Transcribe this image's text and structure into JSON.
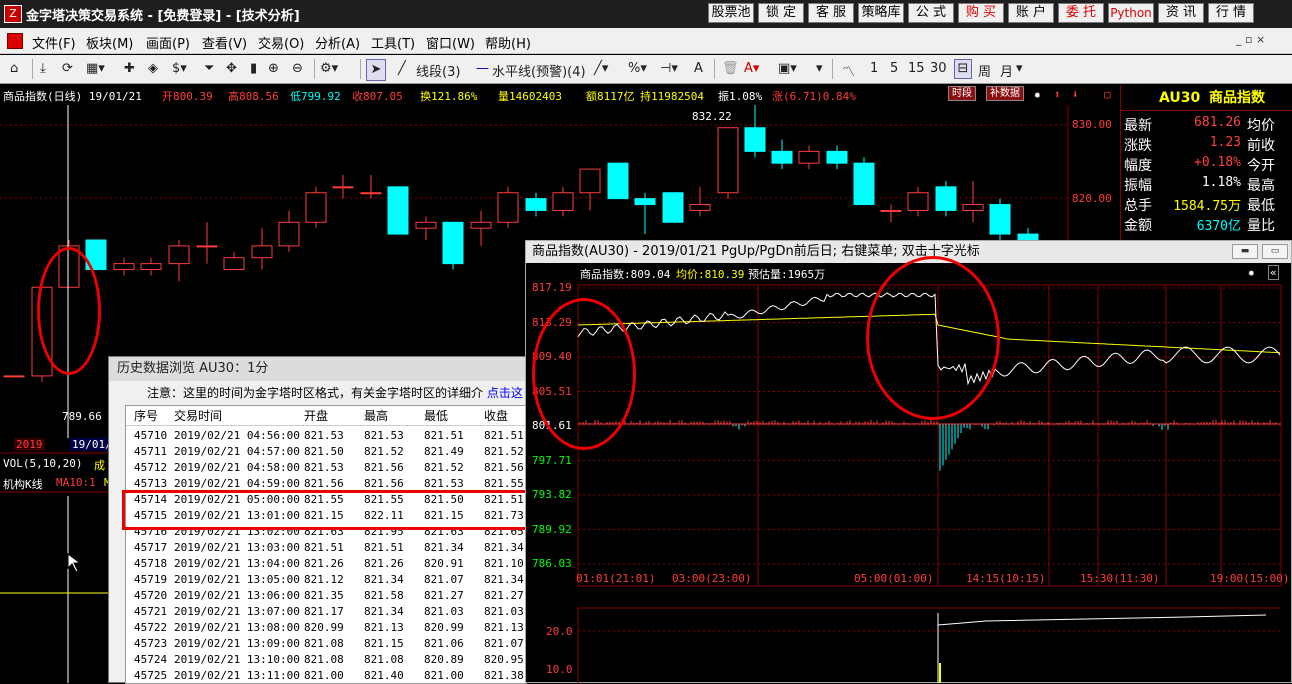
{
  "title": {
    "app_name": "金字塔决策交易系统 - [免费登录] - [技术分析]",
    "logo": "Z",
    "buttons": [
      "股票池",
      "锁 定",
      "客 服",
      "策略库",
      "公 式",
      "购 买",
      "账 户",
      "委 托",
      "Python",
      "资 讯",
      "行 情"
    ],
    "red_buttons": [
      "购 买",
      "委 托",
      "Python"
    ]
  },
  "menu": {
    "items": [
      "文件(F)",
      "板块(M)",
      "画面(P)",
      "查看(V)",
      "交易(O)",
      "分析(A)",
      "工具(T)",
      "窗口(W)",
      "帮助(H)"
    ],
    "extra": "_ ▫ ×"
  },
  "toolbar": {
    "line_tool": "线段(3)",
    "hline_tool": "水平线(预警)(4)",
    "periods": [
      "1",
      "5",
      "15",
      "30"
    ],
    "week": "周",
    "month": "月"
  },
  "info": {
    "name": "商品指数(日线) 19/01/21",
    "open": "开800.39",
    "high": "高808.56",
    "low": "低799.92",
    "close": "收807.05",
    "turnover": "换121.86%",
    "volume": "量14602403",
    "amount": "额8117亿",
    "hold": "持11982504",
    "amp": "振1.08%",
    "change": "涨(6.71)0.84%",
    "badge_timeshare": "时段",
    "badge_fill": "补数据"
  },
  "right_panel": {
    "code": "AU30",
    "name": "商品指数",
    "rows": [
      {
        "k": "最新",
        "v": "681.26",
        "k2": "均价",
        "color": "#ff4040"
      },
      {
        "k": "涨跌",
        "v": "1.23",
        "k2": "前收",
        "color": "#ff4040"
      },
      {
        "k": "幅度",
        "v": "+0.18%",
        "k2": "今开",
        "color": "#ff4040"
      },
      {
        "k": "振幅",
        "v": "1.18%",
        "k2": "最高",
        "color": "#ffffff"
      },
      {
        "k": "总手",
        "v": "1584.75万",
        "k2": "最低",
        "color": "#ffff00"
      },
      {
        "k": "金额",
        "v": "6370亿",
        "k2": "量比",
        "color": "#00ffff"
      }
    ]
  },
  "main_chart": {
    "y_ticks": [
      "830.00",
      "820.00"
    ],
    "price_high_label": "832.22",
    "price_low_label": "789.66",
    "date_label": "2019",
    "date_label2": "19/01/",
    "vol_label": "VOL(5,10,20)",
    "vol_suffix": "成",
    "inst_label": "机构K线",
    "inst_ma": "MA10:1",
    "inst_ma2": "M"
  },
  "history": {
    "title": "历史数据浏览 AU30：1分",
    "note": "注意：这里的时间为金字塔时区格式，有关金字塔时区的详细介",
    "note_link": "点击这",
    "headers": [
      "序号",
      "交易时间",
      "开盘",
      "最高",
      "最低",
      "收盘"
    ],
    "rows": [
      [
        "45710",
        "2019/02/21 04:56:00",
        "821.53",
        "821.53",
        "821.51",
        "821.51"
      ],
      [
        "45711",
        "2019/02/21 04:57:00",
        "821.50",
        "821.52",
        "821.49",
        "821.52"
      ],
      [
        "45712",
        "2019/02/21 04:58:00",
        "821.53",
        "821.56",
        "821.52",
        "821.56"
      ],
      [
        "45713",
        "2019/02/21 04:59:00",
        "821.56",
        "821.56",
        "821.53",
        "821.55"
      ],
      [
        "45714",
        "2019/02/21 05:00:00",
        "821.55",
        "821.55",
        "821.50",
        "821.51"
      ],
      [
        "45715",
        "2019/02/21 13:01:00",
        "821.15",
        "822.11",
        "821.15",
        "821.73"
      ],
      [
        "45716",
        "2019/02/21 13:02:00",
        "821.63",
        "821.95",
        "821.63",
        "821.65"
      ],
      [
        "45717",
        "2019/02/21 13:03:00",
        "821.51",
        "821.51",
        "821.34",
        "821.34"
      ],
      [
        "45718",
        "2019/02/21 13:04:00",
        "821.26",
        "821.26",
        "820.91",
        "821.10"
      ],
      [
        "45719",
        "2019/02/21 13:05:00",
        "821.12",
        "821.34",
        "821.07",
        "821.34"
      ],
      [
        "45720",
        "2019/02/21 13:06:00",
        "821.35",
        "821.58",
        "821.27",
        "821.27"
      ],
      [
        "45721",
        "2019/02/21 13:07:00",
        "821.17",
        "821.34",
        "821.03",
        "821.03"
      ],
      [
        "45722",
        "2019/02/21 13:08:00",
        "820.99",
        "821.13",
        "820.99",
        "821.13"
      ],
      [
        "45723",
        "2019/02/21 13:09:00",
        "821.08",
        "821.15",
        "821.06",
        "821.07"
      ],
      [
        "45724",
        "2019/02/21 13:10:00",
        "821.08",
        "821.08",
        "820.89",
        "820.95"
      ],
      [
        "45725",
        "2019/02/21 13:11:00",
        "821.00",
        "821.40",
        "821.00",
        "821.38"
      ]
    ]
  },
  "intraday": {
    "title": "商品指数(AU30) - 2019/01/21 PgUp/PgDn前后日; 右键菜单; 双击十字光标",
    "info_name": "商品指数:809.04",
    "info_avg": "均价:810.39",
    "info_est": "预估量:1965万",
    "y_labels": [
      "817.19",
      "813.29",
      "809.40",
      "805.51",
      "801.61",
      "797.71",
      "793.82",
      "789.92",
      "786.03"
    ],
    "x_labels": [
      "01:01(21:01)",
      "03:00(23:00)",
      "05:00(01:00)",
      "14:15(10:15)",
      "15:30(11:30)",
      "19:00(15:00)"
    ],
    "vol_labels": [
      "20.0",
      "10.0"
    ]
  },
  "colors": {
    "up": "#ff3c3c",
    "down": "#00ffff",
    "grid": "#800000",
    "highlight": "#e00000",
    "avg_line": "#ffff00"
  }
}
